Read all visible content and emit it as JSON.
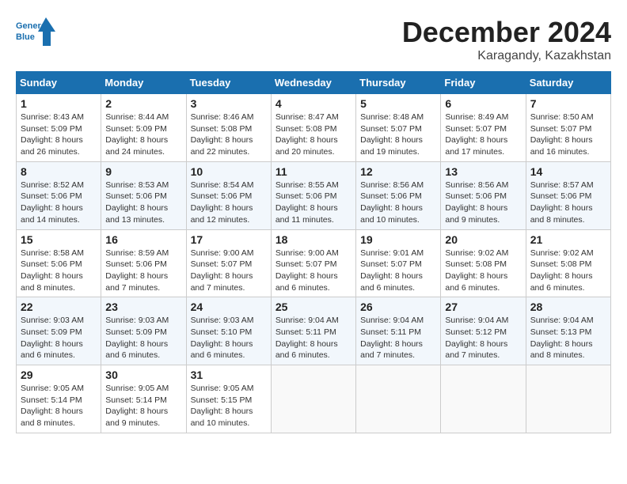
{
  "header": {
    "logo_line1": "General",
    "logo_line2": "Blue",
    "month": "December 2024",
    "location": "Karagandy, Kazakhstan"
  },
  "days_of_week": [
    "Sunday",
    "Monday",
    "Tuesday",
    "Wednesday",
    "Thursday",
    "Friday",
    "Saturday"
  ],
  "weeks": [
    [
      {
        "num": "1",
        "sunrise": "8:43 AM",
        "sunset": "5:09 PM",
        "daylight": "8 hours and 26 minutes."
      },
      {
        "num": "2",
        "sunrise": "8:44 AM",
        "sunset": "5:09 PM",
        "daylight": "8 hours and 24 minutes."
      },
      {
        "num": "3",
        "sunrise": "8:46 AM",
        "sunset": "5:08 PM",
        "daylight": "8 hours and 22 minutes."
      },
      {
        "num": "4",
        "sunrise": "8:47 AM",
        "sunset": "5:08 PM",
        "daylight": "8 hours and 20 minutes."
      },
      {
        "num": "5",
        "sunrise": "8:48 AM",
        "sunset": "5:07 PM",
        "daylight": "8 hours and 19 minutes."
      },
      {
        "num": "6",
        "sunrise": "8:49 AM",
        "sunset": "5:07 PM",
        "daylight": "8 hours and 17 minutes."
      },
      {
        "num": "7",
        "sunrise": "8:50 AM",
        "sunset": "5:07 PM",
        "daylight": "8 hours and 16 minutes."
      }
    ],
    [
      {
        "num": "8",
        "sunrise": "8:52 AM",
        "sunset": "5:06 PM",
        "daylight": "8 hours and 14 minutes."
      },
      {
        "num": "9",
        "sunrise": "8:53 AM",
        "sunset": "5:06 PM",
        "daylight": "8 hours and 13 minutes."
      },
      {
        "num": "10",
        "sunrise": "8:54 AM",
        "sunset": "5:06 PM",
        "daylight": "8 hours and 12 minutes."
      },
      {
        "num": "11",
        "sunrise": "8:55 AM",
        "sunset": "5:06 PM",
        "daylight": "8 hours and 11 minutes."
      },
      {
        "num": "12",
        "sunrise": "8:56 AM",
        "sunset": "5:06 PM",
        "daylight": "8 hours and 10 minutes."
      },
      {
        "num": "13",
        "sunrise": "8:56 AM",
        "sunset": "5:06 PM",
        "daylight": "8 hours and 9 minutes."
      },
      {
        "num": "14",
        "sunrise": "8:57 AM",
        "sunset": "5:06 PM",
        "daylight": "8 hours and 8 minutes."
      }
    ],
    [
      {
        "num": "15",
        "sunrise": "8:58 AM",
        "sunset": "5:06 PM",
        "daylight": "8 hours and 8 minutes."
      },
      {
        "num": "16",
        "sunrise": "8:59 AM",
        "sunset": "5:06 PM",
        "daylight": "8 hours and 7 minutes."
      },
      {
        "num": "17",
        "sunrise": "9:00 AM",
        "sunset": "5:07 PM",
        "daylight": "8 hours and 7 minutes."
      },
      {
        "num": "18",
        "sunrise": "9:00 AM",
        "sunset": "5:07 PM",
        "daylight": "8 hours and 6 minutes."
      },
      {
        "num": "19",
        "sunrise": "9:01 AM",
        "sunset": "5:07 PM",
        "daylight": "8 hours and 6 minutes."
      },
      {
        "num": "20",
        "sunrise": "9:02 AM",
        "sunset": "5:08 PM",
        "daylight": "8 hours and 6 minutes."
      },
      {
        "num": "21",
        "sunrise": "9:02 AM",
        "sunset": "5:08 PM",
        "daylight": "8 hours and 6 minutes."
      }
    ],
    [
      {
        "num": "22",
        "sunrise": "9:03 AM",
        "sunset": "5:09 PM",
        "daylight": "8 hours and 6 minutes."
      },
      {
        "num": "23",
        "sunrise": "9:03 AM",
        "sunset": "5:09 PM",
        "daylight": "8 hours and 6 minutes."
      },
      {
        "num": "24",
        "sunrise": "9:03 AM",
        "sunset": "5:10 PM",
        "daylight": "8 hours and 6 minutes."
      },
      {
        "num": "25",
        "sunrise": "9:04 AM",
        "sunset": "5:11 PM",
        "daylight": "8 hours and 6 minutes."
      },
      {
        "num": "26",
        "sunrise": "9:04 AM",
        "sunset": "5:11 PM",
        "daylight": "8 hours and 7 minutes."
      },
      {
        "num": "27",
        "sunrise": "9:04 AM",
        "sunset": "5:12 PM",
        "daylight": "8 hours and 7 minutes."
      },
      {
        "num": "28",
        "sunrise": "9:04 AM",
        "sunset": "5:13 PM",
        "daylight": "8 hours and 8 minutes."
      }
    ],
    [
      {
        "num": "29",
        "sunrise": "9:05 AM",
        "sunset": "5:14 PM",
        "daylight": "8 hours and 8 minutes."
      },
      {
        "num": "30",
        "sunrise": "9:05 AM",
        "sunset": "5:14 PM",
        "daylight": "8 hours and 9 minutes."
      },
      {
        "num": "31",
        "sunrise": "9:05 AM",
        "sunset": "5:15 PM",
        "daylight": "8 hours and 10 minutes."
      },
      null,
      null,
      null,
      null
    ]
  ]
}
